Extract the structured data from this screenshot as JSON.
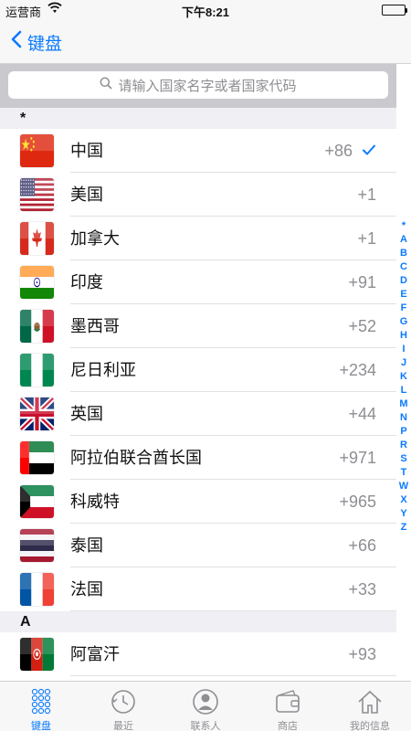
{
  "status": {
    "carrier": "运营商",
    "time": "下午8:21"
  },
  "nav": {
    "back_label": "键盘"
  },
  "search": {
    "placeholder": "请输入国家名字或者国家代码"
  },
  "sections": [
    {
      "header": "*",
      "rows": [
        {
          "name": "中国",
          "code": "+86",
          "flag": "china",
          "selected": true
        },
        {
          "name": "美国",
          "code": "+1",
          "flag": "usa"
        },
        {
          "name": "加拿大",
          "code": "+1",
          "flag": "canada"
        },
        {
          "name": "印度",
          "code": "+91",
          "flag": "india"
        },
        {
          "name": "墨西哥",
          "code": "+52",
          "flag": "mexico"
        },
        {
          "name": "尼日利亚",
          "code": "+234",
          "flag": "nigeria"
        },
        {
          "name": "英国",
          "code": "+44",
          "flag": "uk"
        },
        {
          "name": "阿拉伯联合酋长国",
          "code": "+971",
          "flag": "uae"
        },
        {
          "name": "科威特",
          "code": "+965",
          "flag": "kuwait"
        },
        {
          "name": "泰国",
          "code": "+66",
          "flag": "thailand"
        },
        {
          "name": "法国",
          "code": "+33",
          "flag": "france"
        }
      ]
    },
    {
      "header": "A",
      "rows": [
        {
          "name": "阿富汗",
          "code": "+93",
          "flag": "afghanistan"
        }
      ]
    }
  ],
  "index": [
    "*",
    "A",
    "B",
    "C",
    "D",
    "E",
    "F",
    "G",
    "H",
    "I",
    "J",
    "K",
    "L",
    "M",
    "N",
    "P",
    "R",
    "S",
    "T",
    "W",
    "X",
    "Y",
    "Z"
  ],
  "tabs": [
    {
      "label": "键盘",
      "icon": "keypad-icon",
      "active": true
    },
    {
      "label": "最近",
      "icon": "clock-icon"
    },
    {
      "label": "联系人",
      "icon": "contact-icon"
    },
    {
      "label": "商店",
      "icon": "wallet-icon"
    },
    {
      "label": "我的信息",
      "icon": "home-icon"
    }
  ],
  "colors": {
    "accent": "#0a7afe",
    "section_bg": "#efeff4",
    "secondary_text": "#8e8e93"
  }
}
